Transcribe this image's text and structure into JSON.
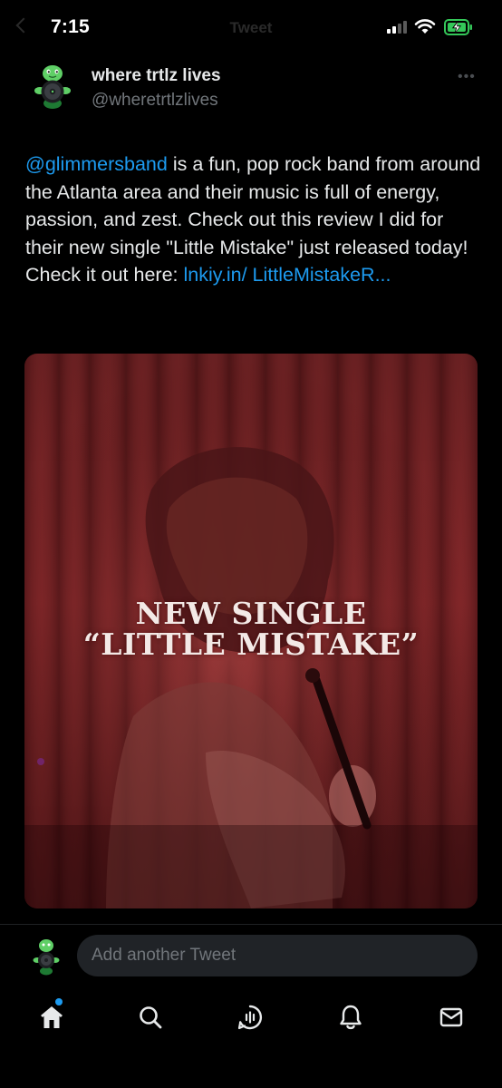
{
  "status_bar": {
    "time": "7:15",
    "faded_title": "Tweet"
  },
  "tweet": {
    "author_name": "where trtlz lives",
    "author_handle": "@wheretrtlzlives",
    "more_label": "•••",
    "text": {
      "mention": "@glimmersband",
      "body": " is a fun, pop rock band from around the Atlanta area and their music is full of energy, passion, and zest. Check out this review I did for their new single \"Little Mistake\" just released today! Check it out here: ",
      "link": "lnkiy.in/ LittleMistakeR..."
    },
    "media": {
      "line1": "NEW SINGLE",
      "line2": "“LITTLE MISTAKE”"
    }
  },
  "reply": {
    "placeholder": "Add another Tweet"
  },
  "tab_bar": {
    "items": [
      {
        "icon": "home-icon",
        "active": true,
        "has_badge": true
      },
      {
        "icon": "search-icon",
        "active": false
      },
      {
        "icon": "spaces-icon",
        "active": false
      },
      {
        "icon": "notifications-icon",
        "active": false
      },
      {
        "icon": "messages-icon",
        "active": false
      }
    ]
  },
  "colors": {
    "background": "#000000",
    "link": "#1d9bf0",
    "text": "#e7e9ea",
    "muted": "#71767b",
    "battery_green": "#34c759"
  }
}
